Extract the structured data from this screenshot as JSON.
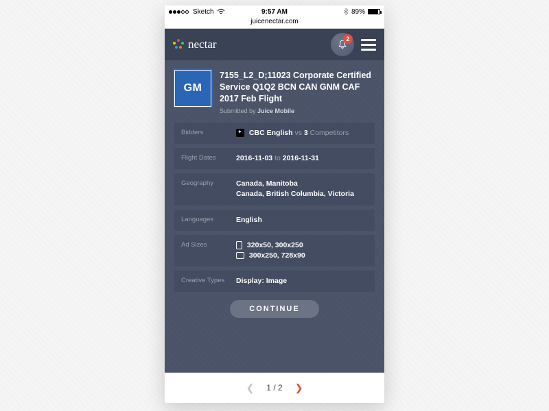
{
  "statusbar": {
    "carrier": "Sketch",
    "wifi": "􀙇",
    "time": "9:57 AM",
    "bluetooth": "✱",
    "battery_pct": "89%"
  },
  "url": "juicenectar.com",
  "brand": "nectar",
  "notification_count": "2",
  "campaign": {
    "logo_text": "GM",
    "title": "7155_L2_D;11023 Corporate Certified Service Q1Q2 BCN CAN GNM CAF 2017 Feb Flight",
    "submitted_prefix": "Submitted by",
    "submitted_by": "Juice Mobile"
  },
  "rows": {
    "bidders": {
      "label": "Bidders",
      "name": "CBC English",
      "vs": "vs",
      "competitors": "3",
      "suffix": "Competitors"
    },
    "flight_dates": {
      "label": "Flight Dates",
      "start": "2016-11-03",
      "mid": "to",
      "end": "2016-11-31"
    },
    "geography": {
      "label": "Geography",
      "line1": "Canada, Manitoba",
      "line2": "Canada, British Columbia, Victoria"
    },
    "languages": {
      "label": "Languages",
      "value": "English"
    },
    "adsizes": {
      "label": "Ad Sizes",
      "line1": "320x50, 300x250",
      "line2": "300x250, 728x90"
    },
    "creative": {
      "label": "Creative Types",
      "value": "Display: Image"
    }
  },
  "continue_label": "CONTINUE",
  "pager": {
    "current": "1",
    "separator": "/",
    "total": "2"
  }
}
